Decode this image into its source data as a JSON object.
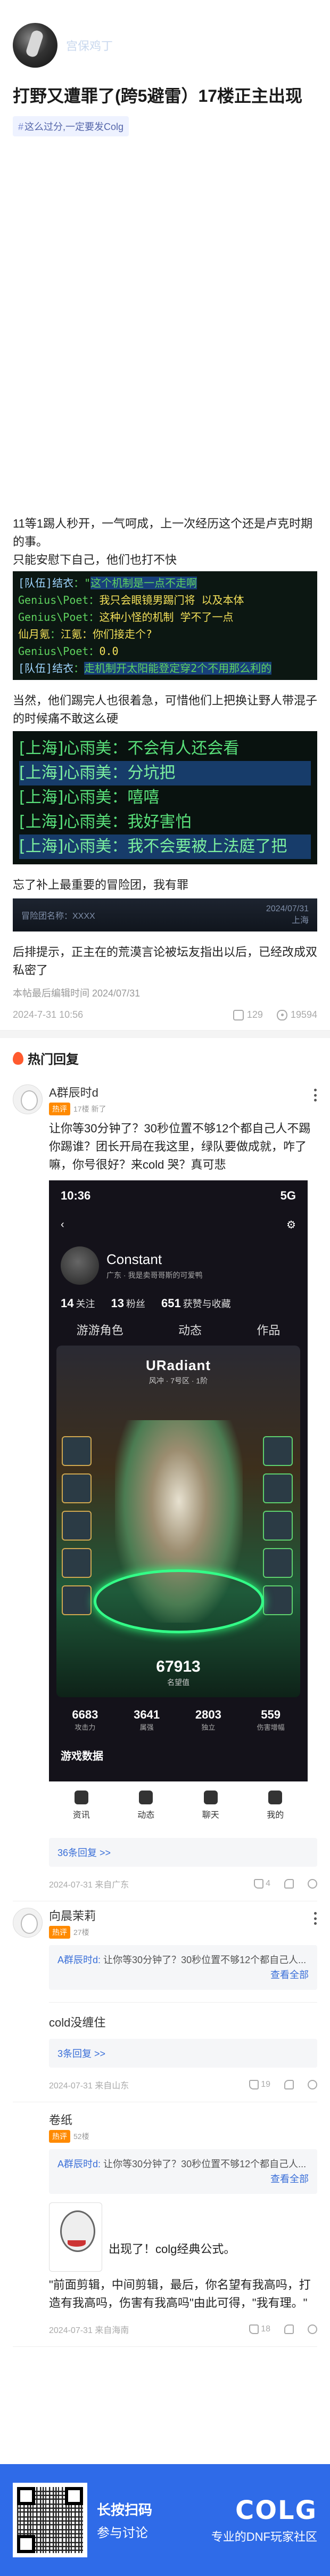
{
  "post": {
    "author_name": "宫保鸡丁",
    "title": "打野又遭罪了(跨5避雷）17楼正主出现",
    "tag": "这么过分,一定要发Colg",
    "paragraphs": {
      "p1": "11等1踢人秒开，一气呵成，上一次经历这个还是卢克时期的事。",
      "p2": "只能安慰下自己，他们也打不快",
      "p3": "当然，他们踢完人也很着急，可惜他们上把换让野人带混子的时候痛不敢这么硬",
      "p4": "忘了补上最重要的冒险团，我有罪",
      "p5": "后排提示，正主在的荒漠言论被坛友指出以后，已经改成双私密了"
    },
    "chat1": [
      {
        "speaker": "[队伍]结衣",
        "text": "这个机制是一点不走啊"
      },
      {
        "speaker": "Genius\\Poet",
        "text": "我只会眼镜男踢门将 以及本体"
      },
      {
        "speaker": "Genius\\Poet",
        "text": "这种小怪的机制 学不了一点"
      },
      {
        "speaker": "仙月氪",
        "text": "江氪：你们接走个?"
      },
      {
        "speaker": "Genius\\Poet",
        "text": "0.0"
      },
      {
        "speaker": "[队伍]结衣",
        "text": "走机制开太阳能登定穿2个不用那么利的"
      }
    ],
    "chat2": [
      "[上海]心雨美：不会有人还会看",
      "[上海]心雨美：分坑把",
      "[上海]心雨美：嘻嘻",
      "[上海]心雨美：我好害怕",
      "[上海]心雨美：我不会要被上法庭了把"
    ],
    "mini_shot": {
      "left": "冒险团名称：XXXX",
      "right_line1": "2024/07/31",
      "right_line2": "上海"
    },
    "edit_note": "本帖最后编辑时间 2024/07/31",
    "timestamp": "2024-7-31 10:56",
    "comment_count": "129",
    "view_count": "19594"
  },
  "hot": {
    "header": "热门回复",
    "comments": [
      {
        "name": "A群辰时d",
        "badge": "热评",
        "level": "17楼 新了",
        "body": "让你等30分钟了？30秒位置不够12个都自己人不踢你踢谁？团长开局在我这里，绿队要做成就，咋了嘛，你号很好？来cold 哭？真可悲",
        "replies_link": "36条回复 >>",
        "time": "2024-07-31 来自广东",
        "likes": "4"
      },
      {
        "name": "向晨茉莉",
        "badge": "热评",
        "level": "27楼",
        "quote_who": "A群辰时d:",
        "quote_text": "让你等30分钟了？30秒位置不够12个都自己人...",
        "quote_expand": "查看全部"
      },
      {
        "name": "cold没缠住",
        "replies_link": "3条回复 >>",
        "time": "2024-07-31 来自山东",
        "likes": "19"
      },
      {
        "name": "卷纸",
        "badge": "热评",
        "level": "52楼",
        "quote_who": "A群辰时d:",
        "quote_text": "让你等30分钟了？30秒位置不够12个都自己人...",
        "quote_expand": "查看全部",
        "meme_caption": "出现了！colg经典公式。",
        "body": "\"前面剪辑，中间剪辑，最后，你名望有我高吗，打造有我高吗，伤害有我高吗\"由此可得，\"我有理。\"",
        "time": "2024-07-31 来自海南",
        "likes": "18"
      }
    ]
  },
  "phone": {
    "time": "10:36",
    "signal": "5G",
    "username": "Constant",
    "location": "广东 · 我是卖哥哥斯的可爱鸭",
    "stats": [
      {
        "n": "14",
        "l": "关注"
      },
      {
        "n": "13",
        "l": "粉丝"
      },
      {
        "n": "651",
        "l": "获赞与收藏"
      }
    ],
    "tabs": [
      "游游角色",
      "动态",
      "作品"
    ],
    "banner_logo": "URadiant",
    "banner_sub": "风冲 · 7号区 · 1阶",
    "rank_value": "67913",
    "rank_label": "名望值",
    "nums": [
      {
        "n": "6683",
        "l": "攻击力"
      },
      {
        "n": "3641",
        "l": "属强"
      },
      {
        "n": "2803",
        "l": "独立"
      },
      {
        "n": "559",
        "l": "伤害增幅"
      }
    ],
    "game_data": "游戏数据",
    "bottom_nav": [
      "资讯",
      "动态",
      "聊天",
      "我的"
    ]
  },
  "footer": {
    "cta1": "长按扫码",
    "cta2": "参与讨论",
    "logo": "COLG",
    "slogan": "专业的DNF玩家社区"
  }
}
